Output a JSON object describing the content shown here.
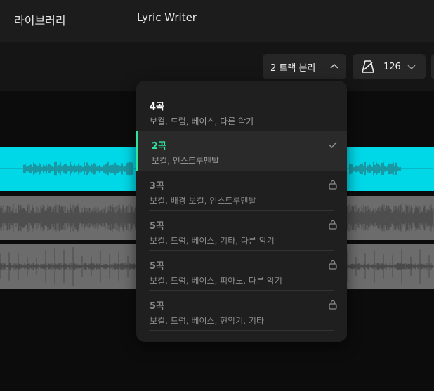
{
  "nav": {
    "library": "라이브러리",
    "lyric_writer": "Lyric Writer"
  },
  "toolbar": {
    "split_label": "2 트랙 분리",
    "tempo_value": "126"
  },
  "split_menu": {
    "options": [
      {
        "title": "4곡",
        "desc": "보컬, 드럼, 베이스, 다른 악기",
        "state": "available"
      },
      {
        "title": "2곡",
        "desc": "보컬, 인스트루멘탈",
        "state": "selected"
      },
      {
        "title": "3곡",
        "desc": "보컬, 배경 보컬, 인스트루멘탈",
        "state": "locked"
      },
      {
        "title": "5곡",
        "desc": "보컬, 드럼, 베이스, 기타, 다른 악기",
        "state": "locked"
      },
      {
        "title": "5곡",
        "desc": "보컬, 드럼, 베이스, 피아노, 다른 악기",
        "state": "locked"
      },
      {
        "title": "5곡",
        "desc": "보컬, 드럼, 베이스, 현악기, 기타",
        "state": "locked"
      }
    ]
  },
  "colors": {
    "accent": "#2ee59d",
    "vocal_track": "#00d8e8",
    "instrument_track": "#6c6c6c"
  },
  "icons": {
    "chevron_up": "chevron-up-icon",
    "metronome": "metronome-icon",
    "chevron_down": "chevron-down-icon",
    "check": "check-icon",
    "lock": "lock-icon"
  }
}
